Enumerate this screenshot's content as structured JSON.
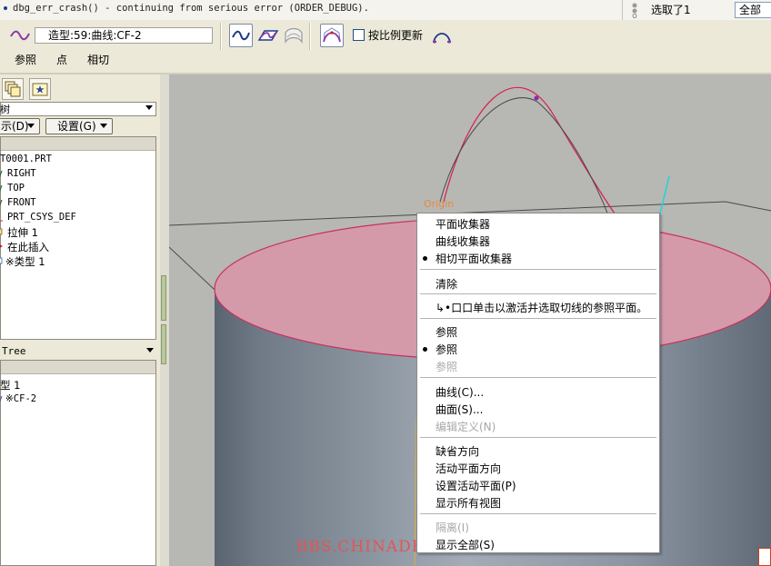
{
  "message_bar": {
    "text": "dbg_err_crash() - continuing from serious error (ORDER_DEBUG).",
    "selection_status": "选取了1",
    "filter_value": "全部"
  },
  "dashboard": {
    "field_label": "造型:59:曲线:CF-2",
    "checkbox_label": "按比例更新",
    "tabs": [
      "参照",
      "点",
      "相切"
    ]
  },
  "left_panel": {
    "tree_header_fragment": "树",
    "show_button": "示(D)",
    "settings_button": "设置(G)",
    "model_tree": [
      "T0001.PRT",
      "RIGHT",
      "TOP",
      "FRONT",
      "PRT_CSYS_DEF",
      "拉伸 1",
      "在此插入",
      "※类型 1"
    ],
    "style_tree_header": "Tree",
    "style_tree": [
      "型 1",
      "※CF-2"
    ]
  },
  "graphics": {
    "origin_label": "Origin",
    "watermark": "BBS.CHINADE.NET"
  },
  "context_menu": {
    "items": [
      {
        "label": "平面收集器",
        "bullet": false,
        "disabled": false
      },
      {
        "label": "曲线收集器",
        "bullet": false,
        "disabled": false
      },
      {
        "label": "相切平面收集器",
        "bullet": true,
        "disabled": false
      },
      {
        "label": "清除",
        "bullet": false,
        "disabled": false
      },
      {
        "label": "↳•口口单击以激活并选取切线的参照平面。",
        "bullet": false,
        "disabled": false
      },
      {
        "label": "参照",
        "bullet": false,
        "disabled": false
      },
      {
        "label": "参照",
        "bullet": true,
        "disabled": false
      },
      {
        "label": "参照",
        "bullet": false,
        "disabled": true
      },
      {
        "label": "曲线(C)...",
        "bullet": false,
        "disabled": false
      },
      {
        "label": "曲面(S)...",
        "bullet": false,
        "disabled": false
      },
      {
        "label": "编辑定义(N)",
        "bullet": false,
        "disabled": true
      },
      {
        "label": "缺省方向",
        "bullet": false,
        "disabled": false
      },
      {
        "label": "活动平面方向",
        "bullet": false,
        "disabled": false
      },
      {
        "label": "设置活动平面(P)",
        "bullet": false,
        "disabled": false
      },
      {
        "label": "显示所有视图",
        "bullet": false,
        "disabled": false
      },
      {
        "label": "隔离(I)",
        "bullet": false,
        "disabled": true
      },
      {
        "label": "显示全部(S)",
        "bullet": false,
        "disabled": false
      }
    ]
  }
}
